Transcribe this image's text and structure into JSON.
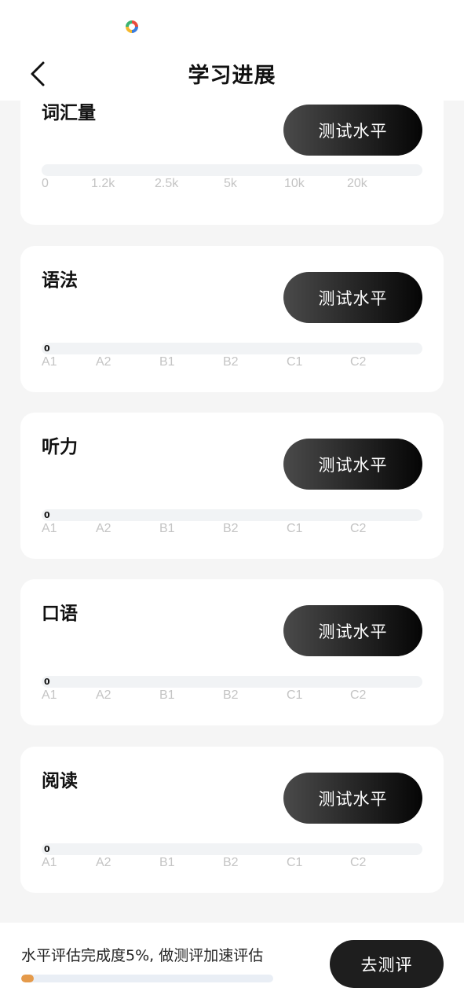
{
  "status_bar": {
    "icon": "app-logo-icon"
  },
  "header": {
    "title": "学习进展",
    "back_icon": "back-arrow-icon"
  },
  "cards": [
    {
      "title": "词汇量",
      "button": "测试水平",
      "value": "",
      "progress": 0,
      "scale": [
        "0",
        "1.2k",
        "2.5k",
        "5k",
        "10k",
        "20k"
      ]
    },
    {
      "title": "语法",
      "button": "测试水平",
      "value": "0",
      "progress": 0,
      "scale": [
        "A1",
        "A2",
        "B1",
        "B2",
        "C1",
        "C2"
      ]
    },
    {
      "title": "听力",
      "button": "测试水平",
      "value": "0",
      "progress": 0,
      "scale": [
        "A1",
        "A2",
        "B1",
        "B2",
        "C1",
        "C2"
      ]
    },
    {
      "title": "口语",
      "button": "测试水平",
      "value": "0",
      "progress": 0,
      "scale": [
        "A1",
        "A2",
        "B1",
        "B2",
        "C1",
        "C2"
      ]
    },
    {
      "title": "阅读",
      "button": "测试水平",
      "value": "0",
      "progress": 0,
      "scale": [
        "A1",
        "A2",
        "B1",
        "B2",
        "C1",
        "C2"
      ]
    }
  ],
  "footer": {
    "progress_text": "水平评估完成度5%, 做测评加速评估",
    "progress": 0.05,
    "button": "去测评"
  },
  "colors": {
    "accent": "#e59a4a",
    "button_dark": "#1e1e1e",
    "track": "#f1f3f5",
    "scale_label": "#c4c4c4"
  }
}
